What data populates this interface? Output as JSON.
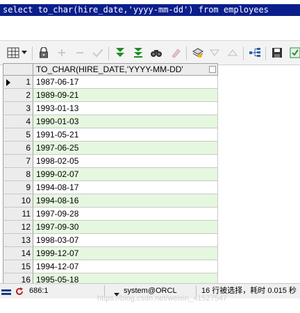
{
  "editor": {
    "sql": "select to_char(hire_date,'yyyy-mm-dd') from employees"
  },
  "toolbar": {
    "icons": [
      "grid-view-icon",
      "dropdown-arrow-icon",
      "lock-icon",
      "add-record-icon",
      "delete-record-icon",
      "post-changes-icon",
      "fetch-next-page-icon",
      "fetch-last-page-icon",
      "find-icon",
      "clear-icon",
      "query-by-example-icon",
      "previous-icon",
      "next-icon",
      "export-icon",
      "save-icon",
      "print-icon"
    ]
  },
  "grid": {
    "column_header": "TO_CHAR(HIRE_DATE,'YYYY-MM-DD'",
    "rows": [
      {
        "num": "1",
        "value": "1987-06-17"
      },
      {
        "num": "2",
        "value": "1989-09-21"
      },
      {
        "num": "3",
        "value": "1993-01-13"
      },
      {
        "num": "4",
        "value": "1990-01-03"
      },
      {
        "num": "5",
        "value": "1991-05-21"
      },
      {
        "num": "6",
        "value": "1997-06-25"
      },
      {
        "num": "7",
        "value": "1998-02-05"
      },
      {
        "num": "8",
        "value": "1999-02-07"
      },
      {
        "num": "9",
        "value": "1994-08-17"
      },
      {
        "num": "10",
        "value": "1994-08-16"
      },
      {
        "num": "11",
        "value": "1997-09-28"
      },
      {
        "num": "12",
        "value": "1997-09-30"
      },
      {
        "num": "13",
        "value": "1998-03-07"
      },
      {
        "num": "14",
        "value": "1999-12-07"
      },
      {
        "num": "15",
        "value": "1994-12-07"
      },
      {
        "num": "16",
        "value": "1995-05-18"
      }
    ],
    "colors": {
      "alt_row": "#e6f7df",
      "header": "#ececec"
    }
  },
  "status": {
    "cursor_position": "686:1",
    "connection": "system@ORCL",
    "message": "16 行被选择，耗时 0.015 秒",
    "watermark": "https://blog.csdn.net/weixin_41527547"
  },
  "colors": {
    "sql_highlight": "#0b1f8c",
    "toolbar_bg": "#f3f3f3"
  }
}
